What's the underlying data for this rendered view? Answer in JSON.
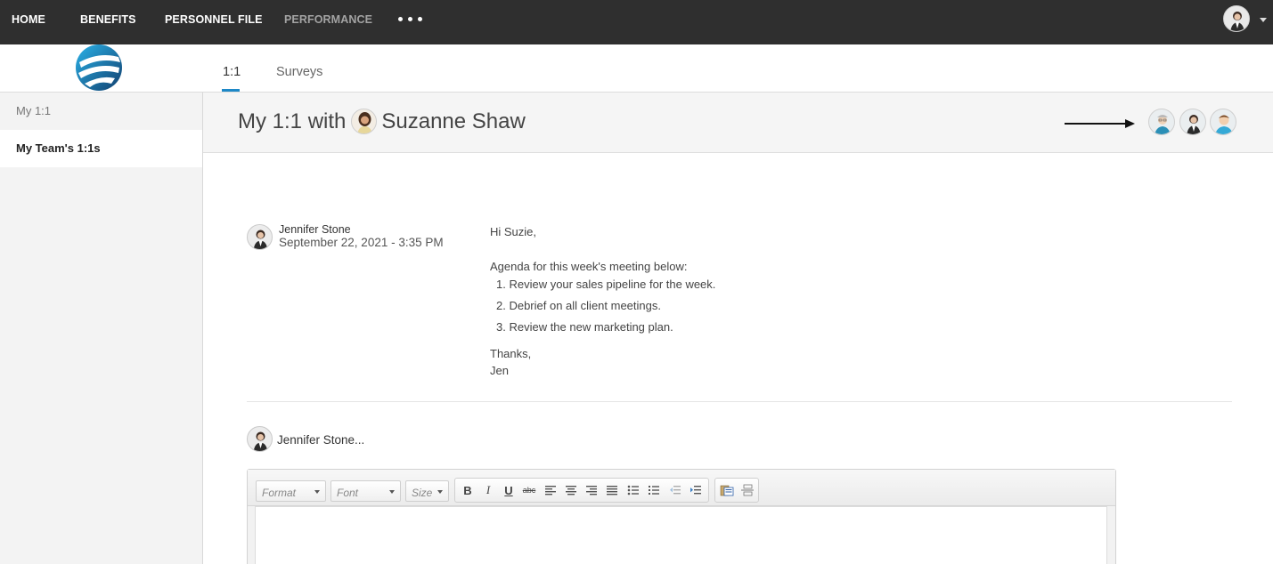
{
  "nav": {
    "items": [
      {
        "label": "HOME"
      },
      {
        "label": "BENEFITS"
      },
      {
        "label": "PERSONNEL FILE"
      },
      {
        "label": "PERFORMANCE"
      }
    ]
  },
  "tabs": [
    {
      "label": "1:1",
      "active": true
    },
    {
      "label": "Surveys",
      "active": false
    }
  ],
  "sidebar": {
    "items": [
      {
        "label": "My 1:1",
        "active": false
      },
      {
        "label": "My Team's 1:1s",
        "active": true
      }
    ]
  },
  "page": {
    "title_prefix": "My 1:1 with",
    "title_person": "Suzanne Shaw"
  },
  "message": {
    "author": "Jennifer Stone",
    "date": "September 22, 2021 - 3:35 PM",
    "greeting": "Hi Suzie,",
    "intro": "Agenda for this week's meeting below:",
    "agenda": [
      "1. Review your sales pipeline for the week.",
      "2. Debrief on all client meetings.",
      "3. Review the new marketing plan."
    ],
    "closing": "Thanks,",
    "signature": "Jen"
  },
  "reply": {
    "author": "Jennifer Stone..."
  },
  "editor": {
    "format_label": "Format",
    "font_label": "Font",
    "size_label": "Size"
  },
  "colors": {
    "nav_bg": "#2f2f2f",
    "accent": "#1e88c7",
    "sidebar_bg": "#f3f3f3"
  }
}
